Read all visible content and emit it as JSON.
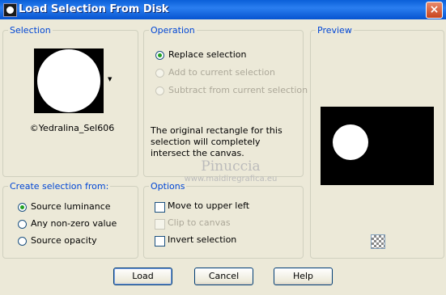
{
  "window": {
    "title": "Load Selection From Disk",
    "close_glyph": "×",
    "icon": "selection-app-icon"
  },
  "selection": {
    "legend": "Selection",
    "file_name": "©Yedralina_Sel606",
    "dropdown_glyph": "▼"
  },
  "operation": {
    "legend": "Operation",
    "options": [
      {
        "label": "Replace selection",
        "checked": true,
        "enabled": true
      },
      {
        "label": "Add to current selection",
        "checked": false,
        "enabled": false
      },
      {
        "label": "Subtract from current selection",
        "checked": false,
        "enabled": false
      }
    ],
    "description": "The original rectangle for this selection will completely intersect the canvas."
  },
  "preview": {
    "legend": "Preview",
    "icon": "checkerboard-icon"
  },
  "create_from": {
    "legend": "Create selection from:",
    "options": [
      {
        "label": "Source luminance",
        "checked": true
      },
      {
        "label": "Any non-zero value",
        "checked": false
      },
      {
        "label": "Source opacity",
        "checked": false
      }
    ]
  },
  "options": {
    "legend": "Options",
    "items": [
      {
        "label": "Move to upper left",
        "checked": false,
        "enabled": true
      },
      {
        "label": "Clip to canvas",
        "checked": false,
        "enabled": false
      },
      {
        "label": "Invert selection",
        "checked": false,
        "enabled": true
      }
    ]
  },
  "watermark": {
    "name": "Pinuccia",
    "site": "www.maidiregrafica.eu"
  },
  "buttons": {
    "load": "Load",
    "cancel": "Cancel",
    "help": "Help"
  },
  "colors": {
    "legend": "#0046d5",
    "titlebar": "#0a5fd8",
    "dialog_bg": "#ece9d8"
  }
}
